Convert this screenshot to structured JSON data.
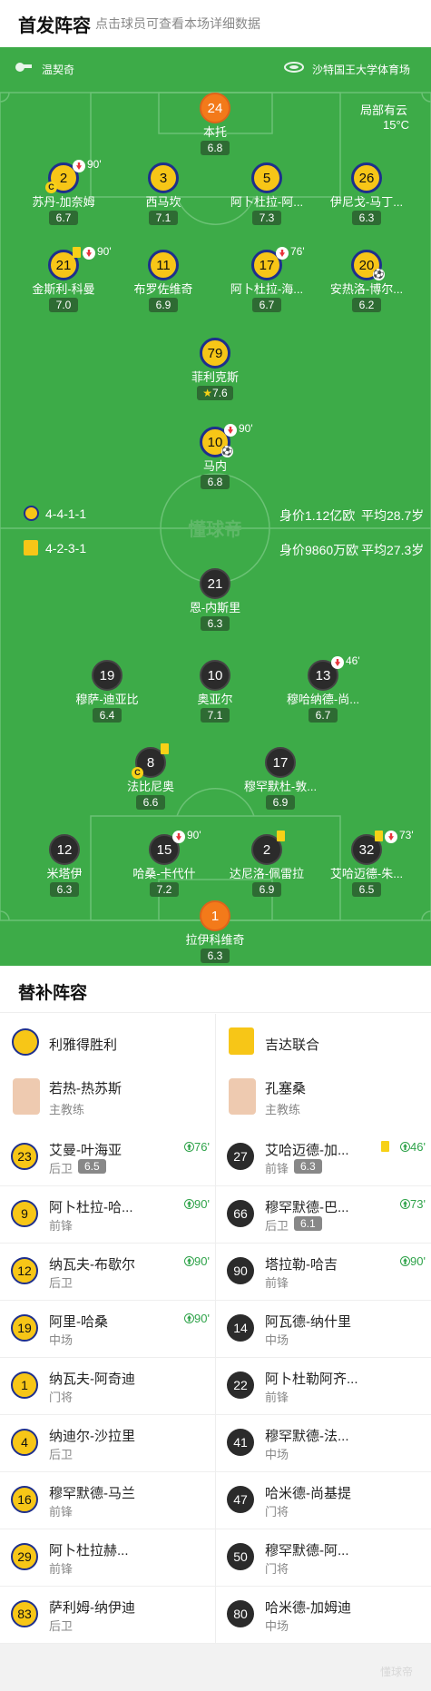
{
  "header": {
    "title": "首发阵容",
    "subtitle": "点击球员可查看本场详细数据"
  },
  "match": {
    "referee": "温契奇",
    "venue": "沙特国王大学体育场",
    "weather": "局部有云",
    "temperature": "15°C"
  },
  "home": {
    "formation": "4-4-1-1",
    "market_value": "身价1.12亿欧",
    "avg_age": "平均28.7岁",
    "team_name": "利雅得胜利",
    "players": [
      {
        "id": "h24",
        "num": "24",
        "name": "本托",
        "rating": "6.8",
        "gk": true
      },
      {
        "id": "h2",
        "num": "2",
        "name": "苏丹-加奈姆",
        "rating": "6.7",
        "captain": true,
        "sub_out": "90'"
      },
      {
        "id": "h3",
        "num": "3",
        "name": "西马坎",
        "rating": "7.1"
      },
      {
        "id": "h5",
        "num": "5",
        "name": "阿卜杜拉-阿...",
        "rating": "7.3"
      },
      {
        "id": "h26",
        "num": "26",
        "name": "伊尼戈-马丁...",
        "rating": "6.3"
      },
      {
        "id": "h21",
        "num": "21",
        "name": "金斯利-科曼",
        "rating": "7.0",
        "yellow": true,
        "sub_out": "90'"
      },
      {
        "id": "h11",
        "num": "11",
        "name": "布罗佐维奇",
        "rating": "6.9"
      },
      {
        "id": "h17",
        "num": "17",
        "name": "阿卜杜拉-海...",
        "rating": "6.7",
        "sub_out": "76'"
      },
      {
        "id": "h20",
        "num": "20",
        "name": "安热洛-博尔...",
        "rating": "6.2",
        "goal": true
      },
      {
        "id": "h79",
        "num": "79",
        "name": "菲利克斯",
        "rating": "7.6",
        "star": true
      },
      {
        "id": "h10",
        "num": "10",
        "name": "马内",
        "rating": "6.8",
        "goal": true,
        "sub_out": "90'"
      }
    ]
  },
  "away": {
    "formation": "4-2-3-1",
    "market_value": "身价9860万欧",
    "avg_age": "平均27.3岁",
    "team_name": "吉达联合",
    "players": [
      {
        "id": "a21",
        "num": "21",
        "name": "恩-内斯里",
        "rating": "6.3"
      },
      {
        "id": "a19",
        "num": "19",
        "name": "穆萨-迪亚比",
        "rating": "6.4"
      },
      {
        "id": "a10",
        "num": "10",
        "name": "奥亚尔",
        "rating": "7.1"
      },
      {
        "id": "a13",
        "num": "13",
        "name": "穆哈纳德-尚...",
        "rating": "6.7",
        "sub_out": "46'"
      },
      {
        "id": "a8",
        "num": "8",
        "name": "法比尼奥",
        "rating": "6.6",
        "captain": true,
        "yellow": true
      },
      {
        "id": "a17",
        "num": "17",
        "name": "穆罕默杜-敦...",
        "rating": "6.9"
      },
      {
        "id": "a12",
        "num": "12",
        "name": "米塔伊",
        "rating": "6.3"
      },
      {
        "id": "a15",
        "num": "15",
        "name": "哈桑-卡代什",
        "rating": "7.2",
        "sub_out": "90'"
      },
      {
        "id": "a2",
        "num": "2",
        "name": "达尼洛-佩雷拉",
        "rating": "6.9",
        "yellow": true
      },
      {
        "id": "a32",
        "num": "32",
        "name": "艾哈迈德-朱...",
        "rating": "6.5",
        "yellow": true,
        "sub_out": "73'"
      },
      {
        "id": "a1",
        "num": "1",
        "name": "拉伊科维奇",
        "rating": "6.3",
        "gk": true
      }
    ]
  },
  "subs": {
    "title": "替补阵容",
    "home_team": "利雅得胜利",
    "away_team": "吉达联合",
    "home_manager": {
      "name": "若热-热苏斯",
      "role": "主教练"
    },
    "away_manager": {
      "name": "孔塞桑",
      "role": "主教练"
    },
    "home": [
      {
        "num": "23",
        "name": "艾曼-叶海亚",
        "pos": "后卫",
        "rating": "6.5",
        "in": "76'"
      },
      {
        "num": "9",
        "name": "阿卜杜拉-哈...",
        "pos": "前锋",
        "in": "90'"
      },
      {
        "num": "12",
        "name": "纳瓦夫-布歇尔",
        "pos": "后卫",
        "in": "90'"
      },
      {
        "num": "19",
        "name": "阿里-哈桑",
        "pos": "中场",
        "in": "90'"
      },
      {
        "num": "1",
        "name": "纳瓦夫-阿奇迪",
        "pos": "门将"
      },
      {
        "num": "4",
        "name": "纳迪尔-沙拉里",
        "pos": "后卫"
      },
      {
        "num": "16",
        "name": "穆罕默德-马兰",
        "pos": "前锋"
      },
      {
        "num": "29",
        "name": "阿卜杜拉赫...",
        "pos": "前锋"
      },
      {
        "num": "83",
        "name": "萨利姆-纳伊迪",
        "pos": "后卫"
      }
    ],
    "away": [
      {
        "num": "27",
        "name": "艾哈迈德-加...",
        "pos": "前锋",
        "rating": "6.3",
        "in": "46'",
        "yellow": true
      },
      {
        "num": "66",
        "name": "穆罕默德-巴...",
        "pos": "后卫",
        "rating": "6.1",
        "in": "73'"
      },
      {
        "num": "90",
        "name": "塔拉勒-哈吉",
        "pos": "前锋",
        "in": "90'"
      },
      {
        "num": "14",
        "name": "阿瓦德-纳什里",
        "pos": "中场"
      },
      {
        "num": "22",
        "name": "阿卜杜勒阿齐...",
        "pos": "前锋"
      },
      {
        "num": "41",
        "name": "穆罕默德-法...",
        "pos": "中场"
      },
      {
        "num": "47",
        "name": "哈米德-尚基提",
        "pos": "门将"
      },
      {
        "num": "50",
        "name": "穆罕默德-阿...",
        "pos": "门将"
      },
      {
        "num": "80",
        "name": "哈米德-加姆迪",
        "pos": "中场"
      }
    ]
  },
  "watermark": "懂球帝",
  "colors": {
    "pitch": "#3dab48",
    "home_primary": "#f7c617",
    "home_secondary": "#1e2f8c",
    "away": "#2b2b2b",
    "sub_in": "#2fa34a",
    "sub_out": "#e8343a"
  }
}
